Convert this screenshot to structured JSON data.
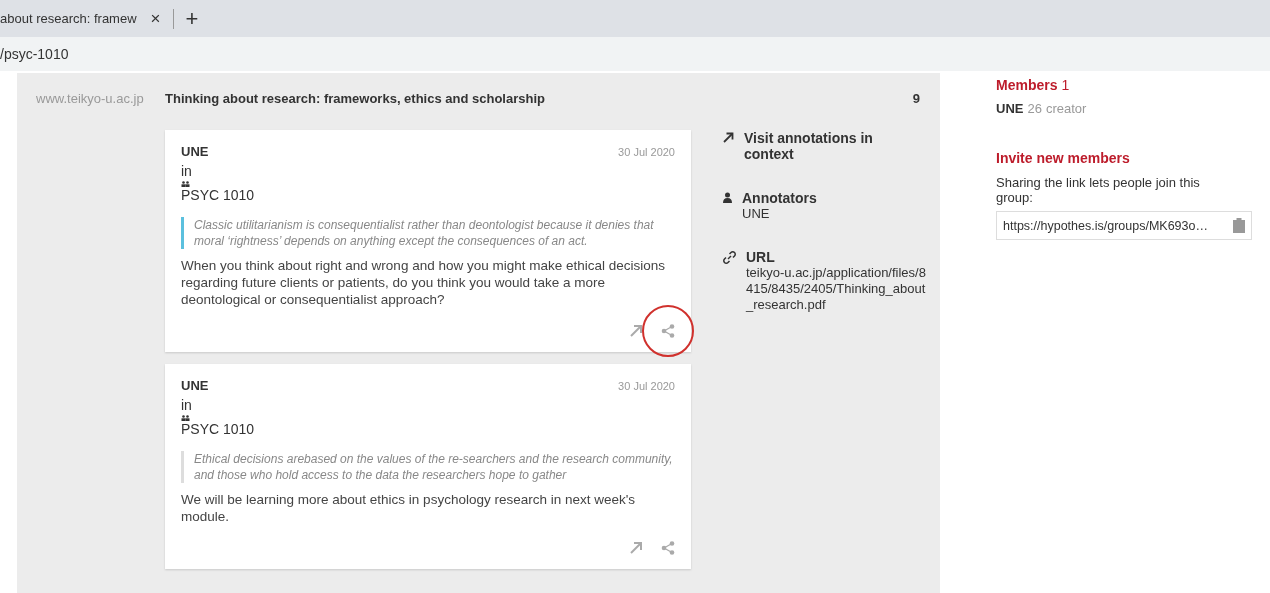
{
  "browser": {
    "tab": {
      "title": "about research: framew",
      "close": "×"
    },
    "new_tab": "+",
    "address": "/psyc-1010"
  },
  "document": {
    "domain": "www.teikyo-u.ac.jp",
    "title": "Thinking about research: frameworks, ethics and scholarship",
    "count": "9"
  },
  "annotations": [
    {
      "user": "UNE",
      "in_label": "in",
      "group": "PSYC 1010",
      "date": "30 Jul 2020",
      "quote": "Classic utilitarianism is consequentialist rather than deontologist because it denies that moral ‘rightness’ depends on anything except the consequences of an act.",
      "color": "#5bc0de",
      "text": "When you think about right and wrong and how you might make ethical decisions regarding future clients or patients, do you think you would take a more deontological or consequentialist approach?",
      "circled": true
    },
    {
      "user": "UNE",
      "in_label": "in",
      "group": "PSYC 1010",
      "date": "30 Jul 2020",
      "quote": "Ethical decisions arebased on the values of the re-searchers and the research community, and those who hold access to the data the researchers hope to gather",
      "color": "#dddddd",
      "text": "We will be learning more about ethics in psychology research in next week's module.",
      "circled": false
    }
  ],
  "details": {
    "visit_link": "Visit annotations in context",
    "annotators_label": "Annotators",
    "annotators": "UNE",
    "url_label": "URL",
    "url": "teikyo-u.ac.jp/application/files/8415/8435/2405/Thinking_about_research.pdf"
  },
  "sidebar": {
    "members_title": "Members",
    "members_count": "1",
    "member": {
      "name": "UNE",
      "count": "26",
      "role": "creator"
    },
    "invite_title": "Invite new members",
    "invite_text": "Sharing the link lets people join this group:",
    "invite_link": "https://hypothes.is/groups/MK693o…"
  }
}
